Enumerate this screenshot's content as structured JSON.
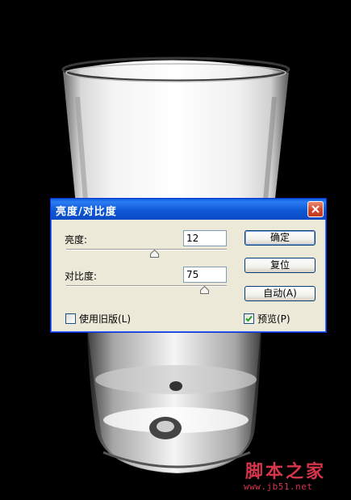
{
  "dialog": {
    "title": "亮度/对比度",
    "brightness_label": "亮度:",
    "brightness_value": "12",
    "brightness_level": 0.55,
    "contrast_label": "对比度:",
    "contrast_value": "75",
    "contrast_level": 0.86,
    "ok_label": "确定",
    "reset_label": "复位",
    "auto_label": "自动(A)",
    "legacy_label": "使用旧版(L)",
    "legacy_checked": false,
    "preview_label": "预览(P)",
    "preview_checked": true
  },
  "watermark": {
    "site_name": "脚本之家",
    "site_url": "www.jb51.net"
  },
  "colors": {
    "title_bar": "#0a5fd9",
    "close_button": "#d2462b",
    "dialog_face": "#ece9d8",
    "watermark": "#d7354d"
  }
}
